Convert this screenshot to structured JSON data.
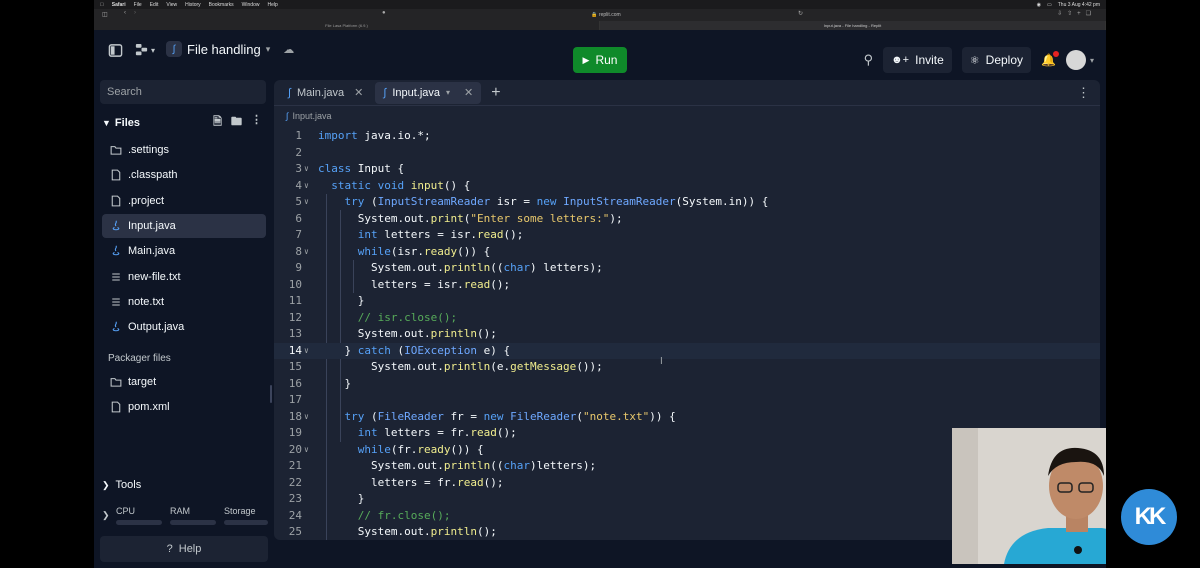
{
  "macos": {
    "app": "Safari",
    "menus": [
      "File",
      "Edit",
      "View",
      "History",
      "Bookmarks",
      "Window",
      "Help"
    ],
    "clock": "Thu 3 Aug 4:42 pm"
  },
  "browser": {
    "url": "replit.com",
    "tabs": [
      "File Lasa Platform (6.9.)",
      "Input.java - File handling - Replit"
    ]
  },
  "topbar": {
    "project_name": "File handling",
    "run_label": "Run",
    "invite_label": "Invite",
    "deploy_label": "Deploy"
  },
  "sidebar": {
    "search_placeholder": "Search",
    "files_title": "Files",
    "files": [
      {
        "name": ".settings",
        "icon": "folder-icon"
      },
      {
        "name": ".classpath",
        "icon": "file-icon"
      },
      {
        "name": ".project",
        "icon": "file-icon"
      },
      {
        "name": "Input.java",
        "icon": "java-icon",
        "selected": true
      },
      {
        "name": "Main.java",
        "icon": "java-icon"
      },
      {
        "name": "new-file.txt",
        "icon": "lines-icon"
      },
      {
        "name": "note.txt",
        "icon": "lines-icon"
      },
      {
        "name": "Output.java",
        "icon": "java-icon"
      }
    ],
    "packager_title": "Packager files",
    "packager_files": [
      {
        "name": "target",
        "icon": "folder-icon"
      },
      {
        "name": "pom.xml",
        "icon": "file-icon"
      }
    ],
    "tools_label": "Tools",
    "meters": [
      "CPU",
      "RAM",
      "Storage"
    ],
    "help_label": "Help"
  },
  "editor": {
    "tabs": [
      {
        "label": "Main.java",
        "active": false
      },
      {
        "label": "Input.java",
        "active": true
      }
    ],
    "breadcrumb": "Input.java",
    "current_line": 14,
    "lines": [
      {
        "n": 1,
        "fold": false,
        "html": "<span class='k'>import</span> java.io.*;"
      },
      {
        "n": 2,
        "fold": false,
        "html": ""
      },
      {
        "n": 3,
        "fold": true,
        "html": "<span class='k'>class</span> Input {"
      },
      {
        "n": 4,
        "fold": true,
        "html": "  <span class='k'>static</span> <span class='k'>void</span> <span class='f'>input</span>() {"
      },
      {
        "n": 5,
        "fold": true,
        "html": "    <span class='k'>try</span> (<span class='t'>InputStreamReader</span> isr = <span class='k'>new</span> <span class='t'>InputStreamReader</span>(System.in)) {"
      },
      {
        "n": 6,
        "fold": false,
        "html": "      System.out.<span class='f'>print</span>(<span class='s'>\"Enter some letters:\"</span>);"
      },
      {
        "n": 7,
        "fold": false,
        "html": "      <span class='k'>int</span> letters = isr.<span class='f'>read</span>();"
      },
      {
        "n": 8,
        "fold": true,
        "html": "      <span class='k'>while</span>(isr.<span class='f'>ready</span>()) {"
      },
      {
        "n": 9,
        "fold": false,
        "html": "        System.out.<span class='f'>println</span>((<span class='k'>char</span>) letters);"
      },
      {
        "n": 10,
        "fold": false,
        "html": "        letters = isr.<span class='f'>read</span>();"
      },
      {
        "n": 11,
        "fold": false,
        "html": "      }"
      },
      {
        "n": 12,
        "fold": false,
        "html": "      <span class='c'>// isr.close();</span>"
      },
      {
        "n": 13,
        "fold": false,
        "html": "      System.out.<span class='f'>println</span>();"
      },
      {
        "n": 14,
        "fold": true,
        "html": "    } <span class='k'>catch</span> (<span class='t'>IOException</span> e) {"
      },
      {
        "n": 15,
        "fold": false,
        "html": "        System.out.<span class='f'>println</span>(e.<span class='f'>getMessage</span>());"
      },
      {
        "n": 16,
        "fold": false,
        "html": "    }"
      },
      {
        "n": 17,
        "fold": false,
        "html": ""
      },
      {
        "n": 18,
        "fold": true,
        "html": "    <span class='k'>try</span> (<span class='t'>FileReader</span> fr = <span class='k'>new</span> <span class='t'>FileReader</span>(<span class='s'>\"note.txt\"</span>)) {"
      },
      {
        "n": 19,
        "fold": false,
        "html": "      <span class='k'>int</span> letters = fr.<span class='f'>read</span>();"
      },
      {
        "n": 20,
        "fold": true,
        "html": "      <span class='k'>while</span>(fr.<span class='f'>ready</span>()) {"
      },
      {
        "n": 21,
        "fold": false,
        "html": "        System.out.<span class='f'>println</span>((<span class='k'>char</span>)letters);"
      },
      {
        "n": 22,
        "fold": false,
        "html": "        letters = fr.<span class='f'>read</span>();"
      },
      {
        "n": 23,
        "fold": false,
        "html": "      }"
      },
      {
        "n": 24,
        "fold": false,
        "html": "      <span class='c'>// fr.close();</span>"
      },
      {
        "n": 25,
        "fold": false,
        "html": "      System.out.<span class='f'>println</span>();"
      }
    ]
  },
  "overlay": {
    "logo_text": "KK"
  },
  "colors": {
    "background": "#0e1525",
    "panel": "#1c2333",
    "selected": "#2b3245",
    "run": "#0f8a2a",
    "logo": "#2f8bd8"
  }
}
